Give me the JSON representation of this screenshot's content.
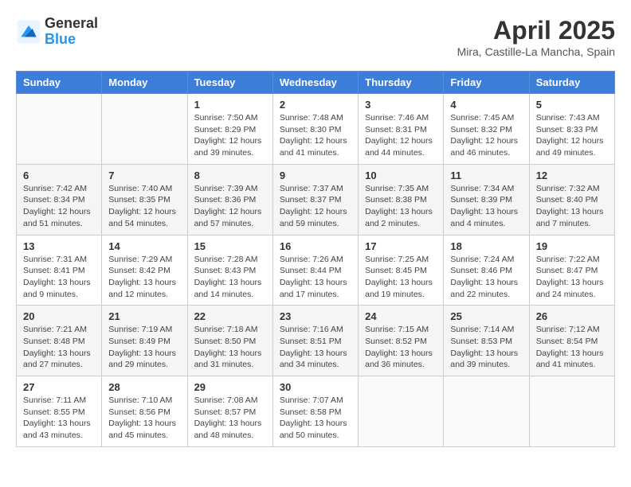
{
  "header": {
    "logo_general": "General",
    "logo_blue": "Blue",
    "month_title": "April 2025",
    "location": "Mira, Castille-La Mancha, Spain"
  },
  "weekdays": [
    "Sunday",
    "Monday",
    "Tuesday",
    "Wednesday",
    "Thursday",
    "Friday",
    "Saturday"
  ],
  "weeks": [
    [
      {
        "day": "",
        "info": ""
      },
      {
        "day": "",
        "info": ""
      },
      {
        "day": "1",
        "info": "Sunrise: 7:50 AM\nSunset: 8:29 PM\nDaylight: 12 hours and 39 minutes."
      },
      {
        "day": "2",
        "info": "Sunrise: 7:48 AM\nSunset: 8:30 PM\nDaylight: 12 hours and 41 minutes."
      },
      {
        "day": "3",
        "info": "Sunrise: 7:46 AM\nSunset: 8:31 PM\nDaylight: 12 hours and 44 minutes."
      },
      {
        "day": "4",
        "info": "Sunrise: 7:45 AM\nSunset: 8:32 PM\nDaylight: 12 hours and 46 minutes."
      },
      {
        "day": "5",
        "info": "Sunrise: 7:43 AM\nSunset: 8:33 PM\nDaylight: 12 hours and 49 minutes."
      }
    ],
    [
      {
        "day": "6",
        "info": "Sunrise: 7:42 AM\nSunset: 8:34 PM\nDaylight: 12 hours and 51 minutes."
      },
      {
        "day": "7",
        "info": "Sunrise: 7:40 AM\nSunset: 8:35 PM\nDaylight: 12 hours and 54 minutes."
      },
      {
        "day": "8",
        "info": "Sunrise: 7:39 AM\nSunset: 8:36 PM\nDaylight: 12 hours and 57 minutes."
      },
      {
        "day": "9",
        "info": "Sunrise: 7:37 AM\nSunset: 8:37 PM\nDaylight: 12 hours and 59 minutes."
      },
      {
        "day": "10",
        "info": "Sunrise: 7:35 AM\nSunset: 8:38 PM\nDaylight: 13 hours and 2 minutes."
      },
      {
        "day": "11",
        "info": "Sunrise: 7:34 AM\nSunset: 8:39 PM\nDaylight: 13 hours and 4 minutes."
      },
      {
        "day": "12",
        "info": "Sunrise: 7:32 AM\nSunset: 8:40 PM\nDaylight: 13 hours and 7 minutes."
      }
    ],
    [
      {
        "day": "13",
        "info": "Sunrise: 7:31 AM\nSunset: 8:41 PM\nDaylight: 13 hours and 9 minutes."
      },
      {
        "day": "14",
        "info": "Sunrise: 7:29 AM\nSunset: 8:42 PM\nDaylight: 13 hours and 12 minutes."
      },
      {
        "day": "15",
        "info": "Sunrise: 7:28 AM\nSunset: 8:43 PM\nDaylight: 13 hours and 14 minutes."
      },
      {
        "day": "16",
        "info": "Sunrise: 7:26 AM\nSunset: 8:44 PM\nDaylight: 13 hours and 17 minutes."
      },
      {
        "day": "17",
        "info": "Sunrise: 7:25 AM\nSunset: 8:45 PM\nDaylight: 13 hours and 19 minutes."
      },
      {
        "day": "18",
        "info": "Sunrise: 7:24 AM\nSunset: 8:46 PM\nDaylight: 13 hours and 22 minutes."
      },
      {
        "day": "19",
        "info": "Sunrise: 7:22 AM\nSunset: 8:47 PM\nDaylight: 13 hours and 24 minutes."
      }
    ],
    [
      {
        "day": "20",
        "info": "Sunrise: 7:21 AM\nSunset: 8:48 PM\nDaylight: 13 hours and 27 minutes."
      },
      {
        "day": "21",
        "info": "Sunrise: 7:19 AM\nSunset: 8:49 PM\nDaylight: 13 hours and 29 minutes."
      },
      {
        "day": "22",
        "info": "Sunrise: 7:18 AM\nSunset: 8:50 PM\nDaylight: 13 hours and 31 minutes."
      },
      {
        "day": "23",
        "info": "Sunrise: 7:16 AM\nSunset: 8:51 PM\nDaylight: 13 hours and 34 minutes."
      },
      {
        "day": "24",
        "info": "Sunrise: 7:15 AM\nSunset: 8:52 PM\nDaylight: 13 hours and 36 minutes."
      },
      {
        "day": "25",
        "info": "Sunrise: 7:14 AM\nSunset: 8:53 PM\nDaylight: 13 hours and 39 minutes."
      },
      {
        "day": "26",
        "info": "Sunrise: 7:12 AM\nSunset: 8:54 PM\nDaylight: 13 hours and 41 minutes."
      }
    ],
    [
      {
        "day": "27",
        "info": "Sunrise: 7:11 AM\nSunset: 8:55 PM\nDaylight: 13 hours and 43 minutes."
      },
      {
        "day": "28",
        "info": "Sunrise: 7:10 AM\nSunset: 8:56 PM\nDaylight: 13 hours and 45 minutes."
      },
      {
        "day": "29",
        "info": "Sunrise: 7:08 AM\nSunset: 8:57 PM\nDaylight: 13 hours and 48 minutes."
      },
      {
        "day": "30",
        "info": "Sunrise: 7:07 AM\nSunset: 8:58 PM\nDaylight: 13 hours and 50 minutes."
      },
      {
        "day": "",
        "info": ""
      },
      {
        "day": "",
        "info": ""
      },
      {
        "day": "",
        "info": ""
      }
    ]
  ]
}
